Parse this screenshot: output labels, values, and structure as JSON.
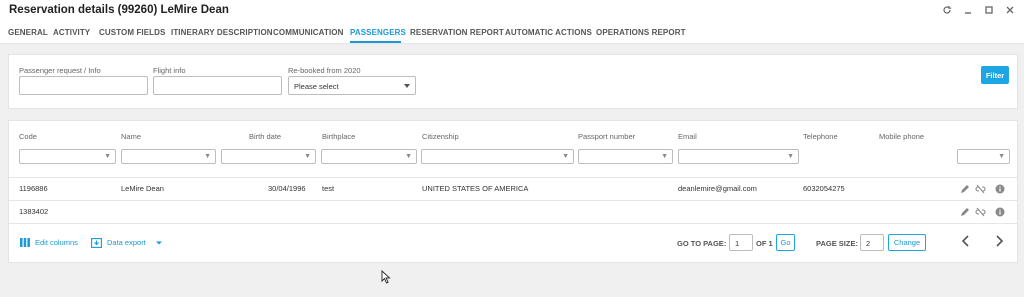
{
  "window": {
    "title": "Reservation details (99260) LeMire Dean",
    "controls": [
      "refresh-icon",
      "minimize-icon",
      "maximize-icon",
      "close-icon"
    ]
  },
  "tabs": [
    {
      "label": "GENERAL"
    },
    {
      "label": "ACTIVITY"
    },
    {
      "label": "CUSTOM FIELDS"
    },
    {
      "label": "ITINERARY DESCRIPTION"
    },
    {
      "label": "COMMUNICATION"
    },
    {
      "label": "PASSENGERS"
    },
    {
      "label": "RESERVATION REPORT"
    },
    {
      "label": "AUTOMATIC ACTIONS"
    },
    {
      "label": "OPERATIONS REPORT"
    }
  ],
  "active_tab": "PASSENGERS",
  "filters": {
    "passenger_request_label": "Passenger request / Info",
    "passenger_request_value": "",
    "flight_info_label": "Flight info",
    "flight_info_value": "",
    "rebooked_label": "Re-booked from 2020",
    "rebooked_value": "Please select",
    "filter_button": "Filter"
  },
  "table": {
    "columns": [
      "Code",
      "Name",
      "Birth date",
      "Birthplace",
      "Citizenship",
      "Passport number",
      "Email",
      "Telephone",
      "Mobile phone"
    ],
    "rows": [
      {
        "code": "1196886",
        "name": "LeMire Dean",
        "birth_date": "30/04/1996",
        "birthplace": "test",
        "citizenship": "UNITED STATES OF AMERICA",
        "passport": "",
        "email": "deanlemire@gmail.com",
        "telephone": "6032054275",
        "mobile": ""
      },
      {
        "code": "1383402",
        "name": "",
        "birth_date": "",
        "birthplace": "",
        "citizenship": "",
        "passport": "",
        "email": "",
        "telephone": "",
        "mobile": ""
      }
    ],
    "row_actions": [
      "edit-icon",
      "unlink-icon",
      "info-icon"
    ]
  },
  "footer": {
    "edit_columns": "Edit columns",
    "data_export": "Data export",
    "go_to_page_label": "GO TO PAGE:",
    "page_value": "1",
    "of_label": "OF 1",
    "go_button": "Go",
    "page_size_label": "PAGE SIZE:",
    "page_size_value": "2",
    "change_button": "Change"
  },
  "colors": {
    "accent": "#1ea5e4",
    "active_tab": "#1a9ad6"
  }
}
